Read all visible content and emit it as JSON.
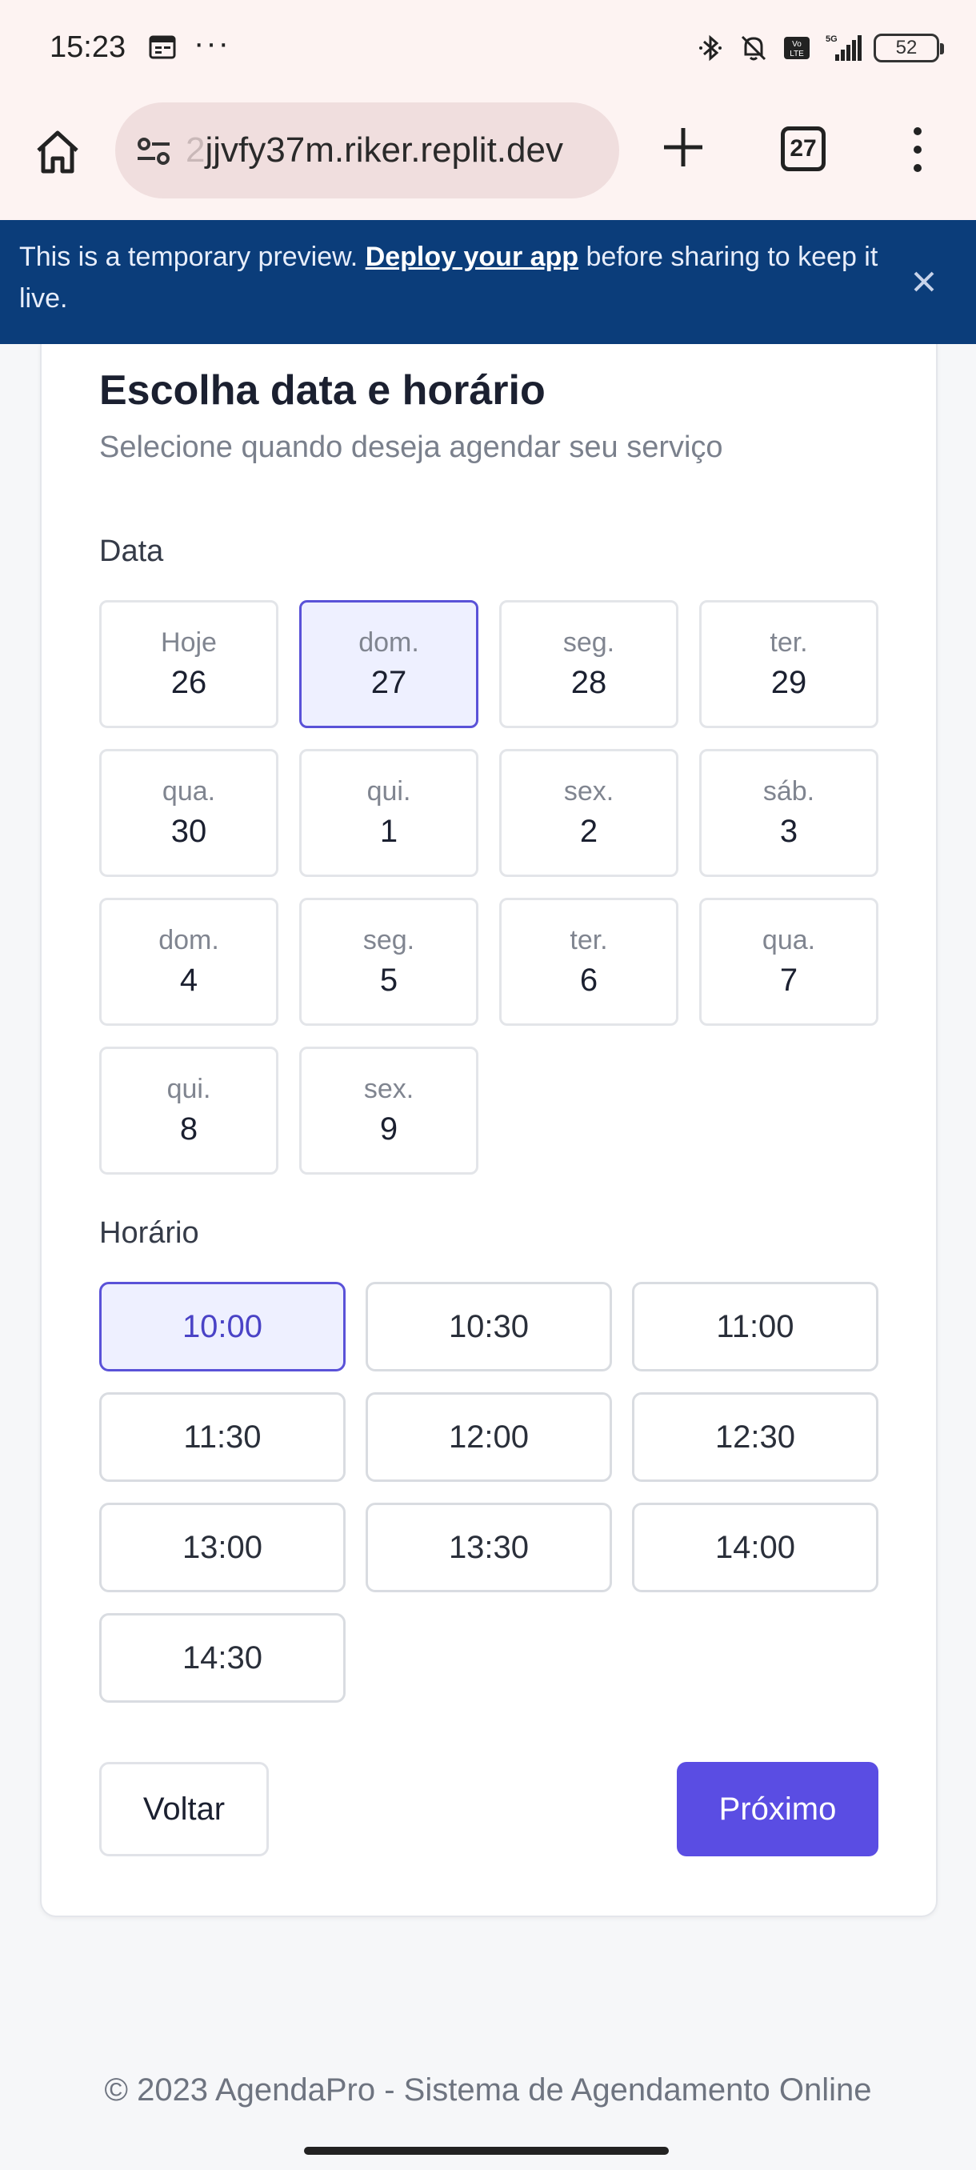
{
  "status_bar": {
    "time": "15:23",
    "dots": "···",
    "network": "5G",
    "volte": "Vo LTE",
    "battery": "52"
  },
  "browser": {
    "url_faded": "2",
    "url": "jjvfy37m.riker.replit.dev",
    "tab_count": "27"
  },
  "banner": {
    "text_before": "This is a temporary preview. ",
    "link": "Deploy your app",
    "text_after": " before sharing to keep it live."
  },
  "page": {
    "title": "Escolha data e horário",
    "subtitle": "Selecione quando deseja agendar seu serviço",
    "date_label": "Data",
    "time_label": "Horário",
    "dates": [
      {
        "day": "Hoje",
        "num": "26"
      },
      {
        "day": "dom.",
        "num": "27",
        "selected": true
      },
      {
        "day": "seg.",
        "num": "28"
      },
      {
        "day": "ter.",
        "num": "29"
      },
      {
        "day": "qua.",
        "num": "30"
      },
      {
        "day": "qui.",
        "num": "1"
      },
      {
        "day": "sex.",
        "num": "2"
      },
      {
        "day": "sáb.",
        "num": "3"
      },
      {
        "day": "dom.",
        "num": "4"
      },
      {
        "day": "seg.",
        "num": "5"
      },
      {
        "day": "ter.",
        "num": "6"
      },
      {
        "day": "qua.",
        "num": "7"
      },
      {
        "day": "qui.",
        "num": "8"
      },
      {
        "day": "sex.",
        "num": "9"
      }
    ],
    "times": [
      {
        "label": "10:00",
        "selected": true
      },
      {
        "label": "10:30"
      },
      {
        "label": "11:00"
      },
      {
        "label": "11:30"
      },
      {
        "label": "12:00"
      },
      {
        "label": "12:30"
      },
      {
        "label": "13:00"
      },
      {
        "label": "13:30"
      },
      {
        "label": "14:00"
      },
      {
        "label": "14:30"
      }
    ],
    "back_label": "Voltar",
    "next_label": "Próximo"
  },
  "footer": "© 2023 AgendaPro - Sistema de Agendamento Online",
  "colors": {
    "accent": "#5a4de3",
    "banner_bg": "#0b3d7a",
    "selected_bg": "#eef0ff"
  }
}
